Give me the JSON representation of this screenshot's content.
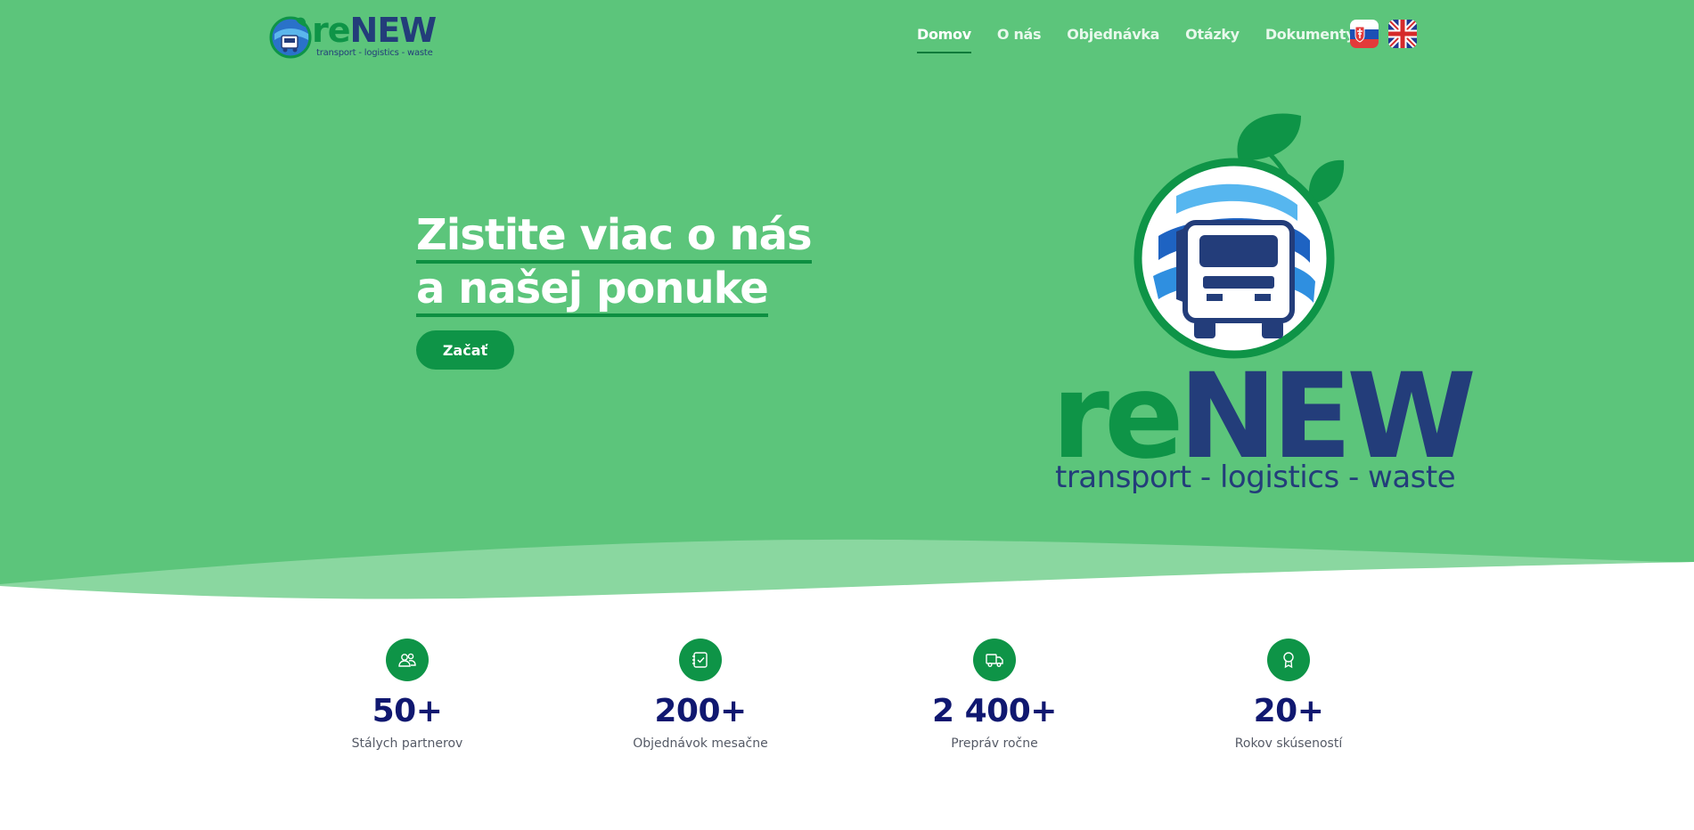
{
  "brand": {
    "logo_re": "re",
    "logo_new": "NEW",
    "tagline": "transport - logistics - waste",
    "colors": {
      "hero_bg": "#5cc57b",
      "accent_green": "#0e9447",
      "brand_navy": "#233d7a",
      "stat_navy": "#101870"
    }
  },
  "nav": {
    "items": [
      {
        "label": "Domov",
        "active": true
      },
      {
        "label": "O nás"
      },
      {
        "label": "Objednávka"
      },
      {
        "label": "Otázky"
      },
      {
        "label": "Dokumenty"
      }
    ],
    "languages": [
      {
        "code": "sk",
        "icon": "slovak-flag-icon"
      },
      {
        "code": "en",
        "icon": "uk-flag-icon"
      }
    ]
  },
  "hero": {
    "title_line1": "Zistite viac o nás",
    "title_line2": "a našej ponuke",
    "cta_label": "Začať"
  },
  "stats": [
    {
      "icon": "partners-icon",
      "value": "50+",
      "label": "Stálych partnerov"
    },
    {
      "icon": "orders-icon",
      "value": "200+",
      "label": "Objednávok mesačne"
    },
    {
      "icon": "truck-icon",
      "value": "2 400+",
      "label": "Prepráv ročne"
    },
    {
      "icon": "award-icon",
      "value": "20+",
      "label": "Rokov skúseností"
    }
  ]
}
